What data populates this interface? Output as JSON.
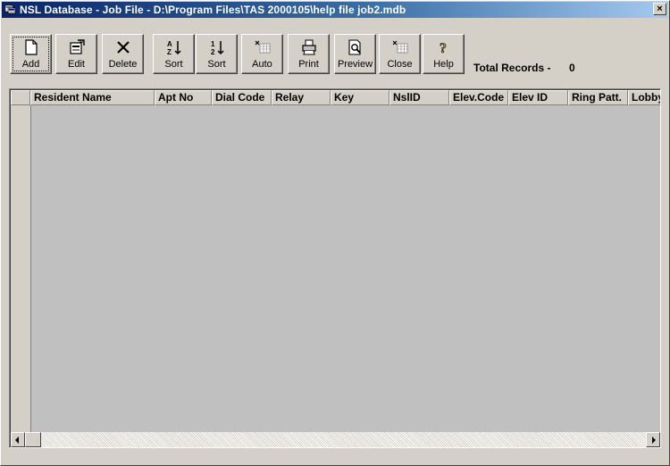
{
  "window": {
    "title": "NSL Database - Job File - D:\\Program Files\\TAS 2000105\\help file job2.mdb",
    "close_glyph": "×"
  },
  "toolbar": {
    "buttons": [
      {
        "label": "Add",
        "icon": "new-document-icon"
      },
      {
        "label": "Edit",
        "icon": "edit-form-icon"
      },
      {
        "label": "Delete",
        "icon": "delete-x-icon"
      },
      {
        "label": "Sort",
        "icon": "sort-az-icon"
      },
      {
        "label": "Sort",
        "icon": "sort-12-icon"
      },
      {
        "label": "Auto",
        "icon": "auto-grid-icon"
      },
      {
        "label": "Print",
        "icon": "printer-icon"
      },
      {
        "label": "Preview",
        "icon": "print-preview-icon"
      },
      {
        "label": "Close",
        "icon": "close-grid-icon"
      },
      {
        "label": "Help",
        "icon": "help-question-icon"
      }
    ]
  },
  "records": {
    "label": "Total Records -",
    "value": "0"
  },
  "grid": {
    "columns": [
      "Resident Name",
      "Apt No",
      "Dial Code",
      "Relay",
      "Key",
      "NslID",
      "Elev.Code",
      "Elev ID",
      "Ring Patt.",
      "Lobby"
    ],
    "rows": []
  },
  "colors": {
    "title_gradient_start": "#0a246a",
    "title_gradient_end": "#a6caf0",
    "face": "#d4d0c8",
    "grid_background": "#c0c0c0"
  }
}
